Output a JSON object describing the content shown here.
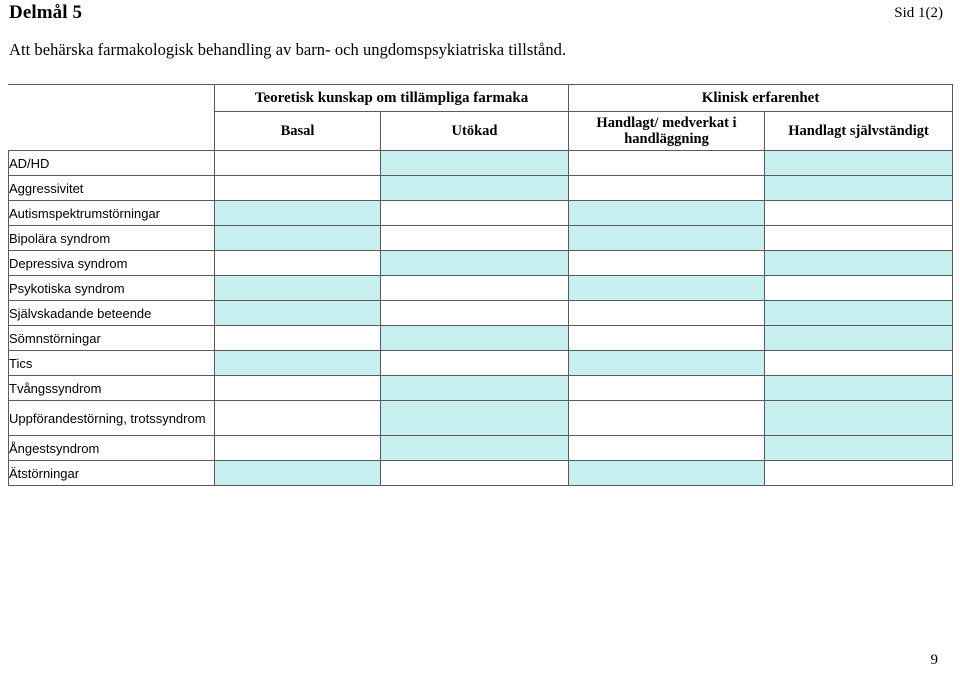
{
  "header": {
    "title": "Delmål 5",
    "page_id": "Sid 1(2)",
    "subtitle": "Att behärska farmakologisk behandling av barn- och ungdomspsykiatriska tillstånd."
  },
  "table": {
    "corner_label": "",
    "group_headers": [
      {
        "label": "Teoretisk kunskap om tillämpliga farmaka",
        "span": 2
      },
      {
        "label": "Klinisk erfarenhet",
        "span": 2
      }
    ],
    "column_headers": [
      "Basal",
      "Utökad",
      "Handlagt/ medverkat i handläggning",
      "Handlagt självständigt"
    ],
    "rows": [
      {
        "label": "AD/HD",
        "cells": [
          0,
          1,
          0,
          1
        ],
        "tall": false
      },
      {
        "label": "Aggressivitet",
        "cells": [
          0,
          1,
          0,
          1
        ],
        "tall": false
      },
      {
        "label": "Autismspektrumstörningar",
        "cells": [
          1,
          0,
          1,
          0
        ],
        "tall": false
      },
      {
        "label": "Bipolära syndrom",
        "cells": [
          1,
          0,
          1,
          0
        ],
        "tall": false
      },
      {
        "label": "Depressiva syndrom",
        "cells": [
          0,
          1,
          0,
          1
        ],
        "tall": false
      },
      {
        "label": "Psykotiska syndrom",
        "cells": [
          1,
          0,
          1,
          0
        ],
        "tall": false
      },
      {
        "label": "Självskadande beteende",
        "cells": [
          1,
          0,
          0,
          1
        ],
        "tall": false
      },
      {
        "label": "Sömnstörningar",
        "cells": [
          0,
          1,
          0,
          1
        ],
        "tall": false
      },
      {
        "label": "Tics",
        "cells": [
          1,
          0,
          1,
          0
        ],
        "tall": false
      },
      {
        "label": "Tvångssyndrom",
        "cells": [
          0,
          1,
          0,
          1
        ],
        "tall": false
      },
      {
        "label": "Uppförandestörning, trotssyndrom",
        "cells": [
          0,
          1,
          0,
          1
        ],
        "tall": true
      },
      {
        "label": "Ångestsyndrom",
        "cells": [
          0,
          1,
          0,
          1
        ],
        "tall": false
      },
      {
        "label": "Ätstörningar",
        "cells": [
          1,
          0,
          1,
          0
        ],
        "tall": false
      }
    ]
  },
  "footer": {
    "page_number": "9"
  },
  "colors": {
    "cell_fill": "#c8efef",
    "grid_line": "#5b5b5b",
    "text": "#000000"
  }
}
